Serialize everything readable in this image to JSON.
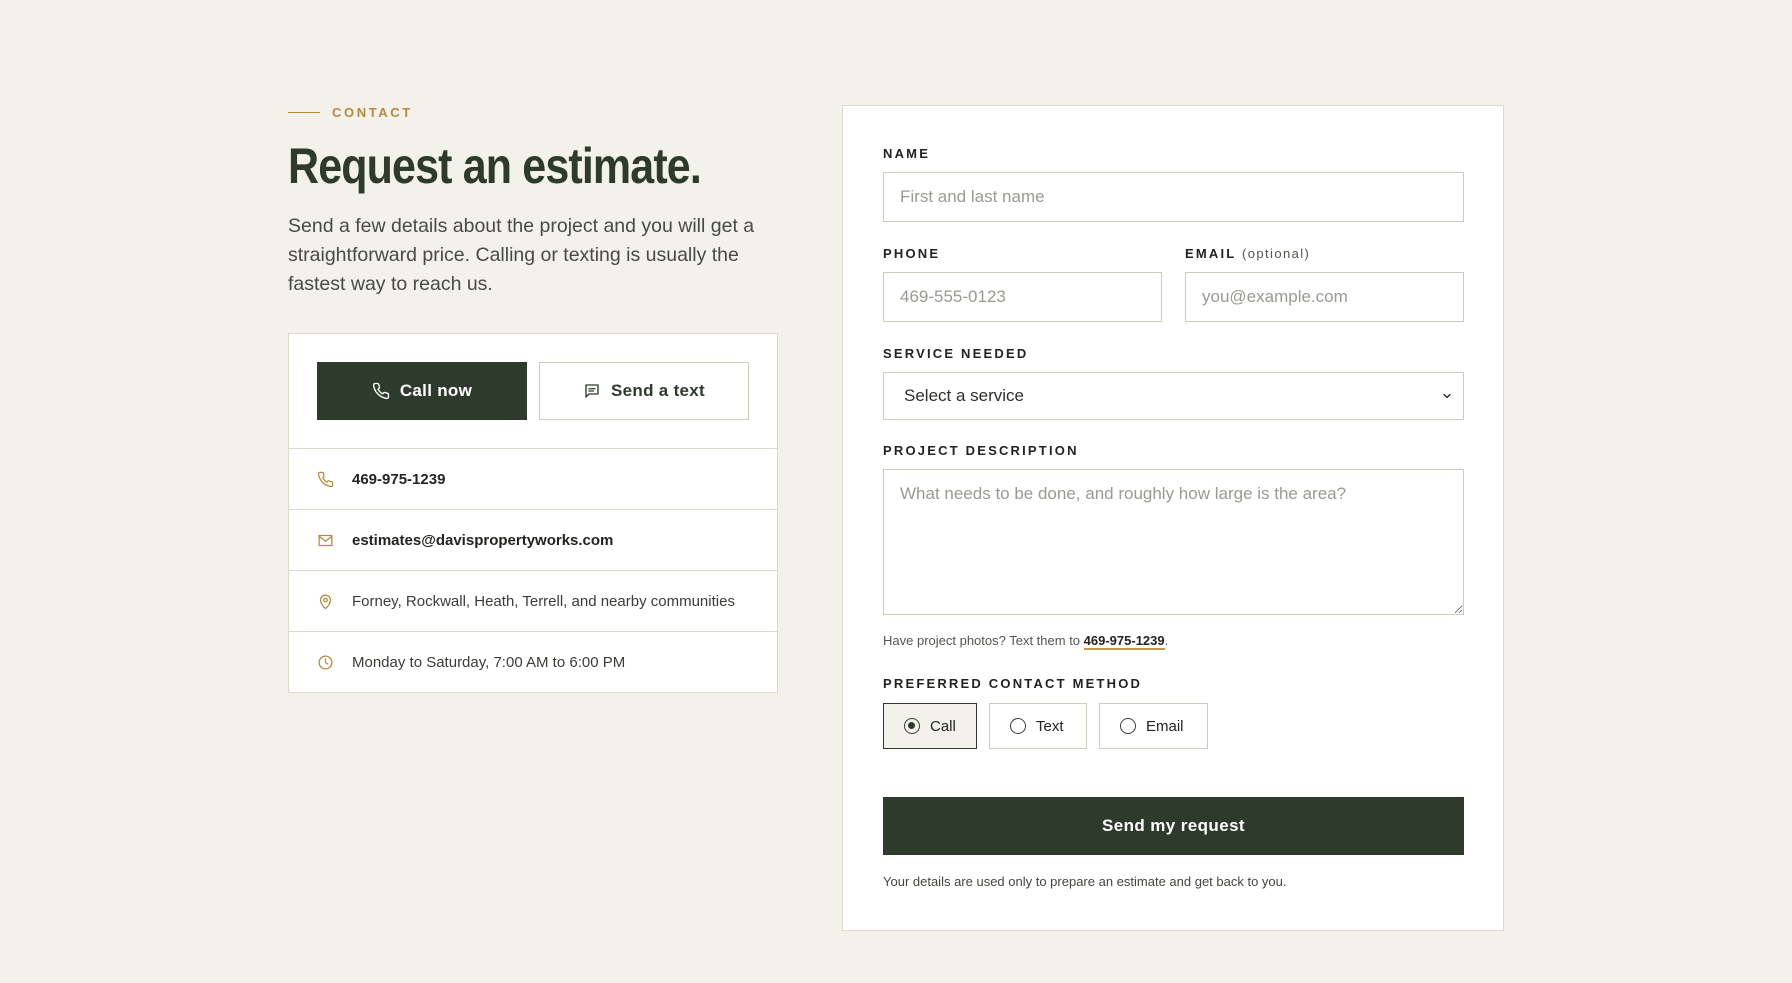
{
  "intro": {
    "eyebrow": "CONTACT",
    "title": "Request an estimate.",
    "lead": "Send a few details about the project and you will get a straightforward price. Calling or texting is usually the fastest way to reach us."
  },
  "contact_card": {
    "call_button": "Call now",
    "text_button": "Send a text",
    "phone": "469-975-1239",
    "email": "estimates@davispropertyworks.com",
    "area": "Forney, Rockwall, Heath, Terrell, and nearby communities",
    "hours": "Monday to Saturday, 7:00 AM to 6:00 PM"
  },
  "form": {
    "name_label": "NAME",
    "name_placeholder": "First and last name",
    "phone_label": "PHONE",
    "phone_placeholder": "469-555-0123",
    "email_label": "EMAIL",
    "email_optional": "(optional)",
    "email_placeholder": "you@example.com",
    "service_label": "SERVICE NEEDED",
    "service_selected": "Select a service",
    "description_label": "PROJECT DESCRIPTION",
    "description_placeholder": "What needs to be done, and roughly how large is the area?",
    "hint_text": "Have project photos? Text them to ",
    "hint_phone": "469-975-1239",
    "hint_end": ".",
    "contact_method_label": "PREFERRED CONTACT METHOD",
    "methods": [
      "Call",
      "Text",
      "Email"
    ],
    "selected_method": "Call",
    "submit_label": "Send my request",
    "privacy_note": "Your details are used only to prepare an estimate and get back to you."
  },
  "colors": {
    "background": "#f2f1ea",
    "primary": "#2e3b2c",
    "accent": "#b58a3e"
  }
}
